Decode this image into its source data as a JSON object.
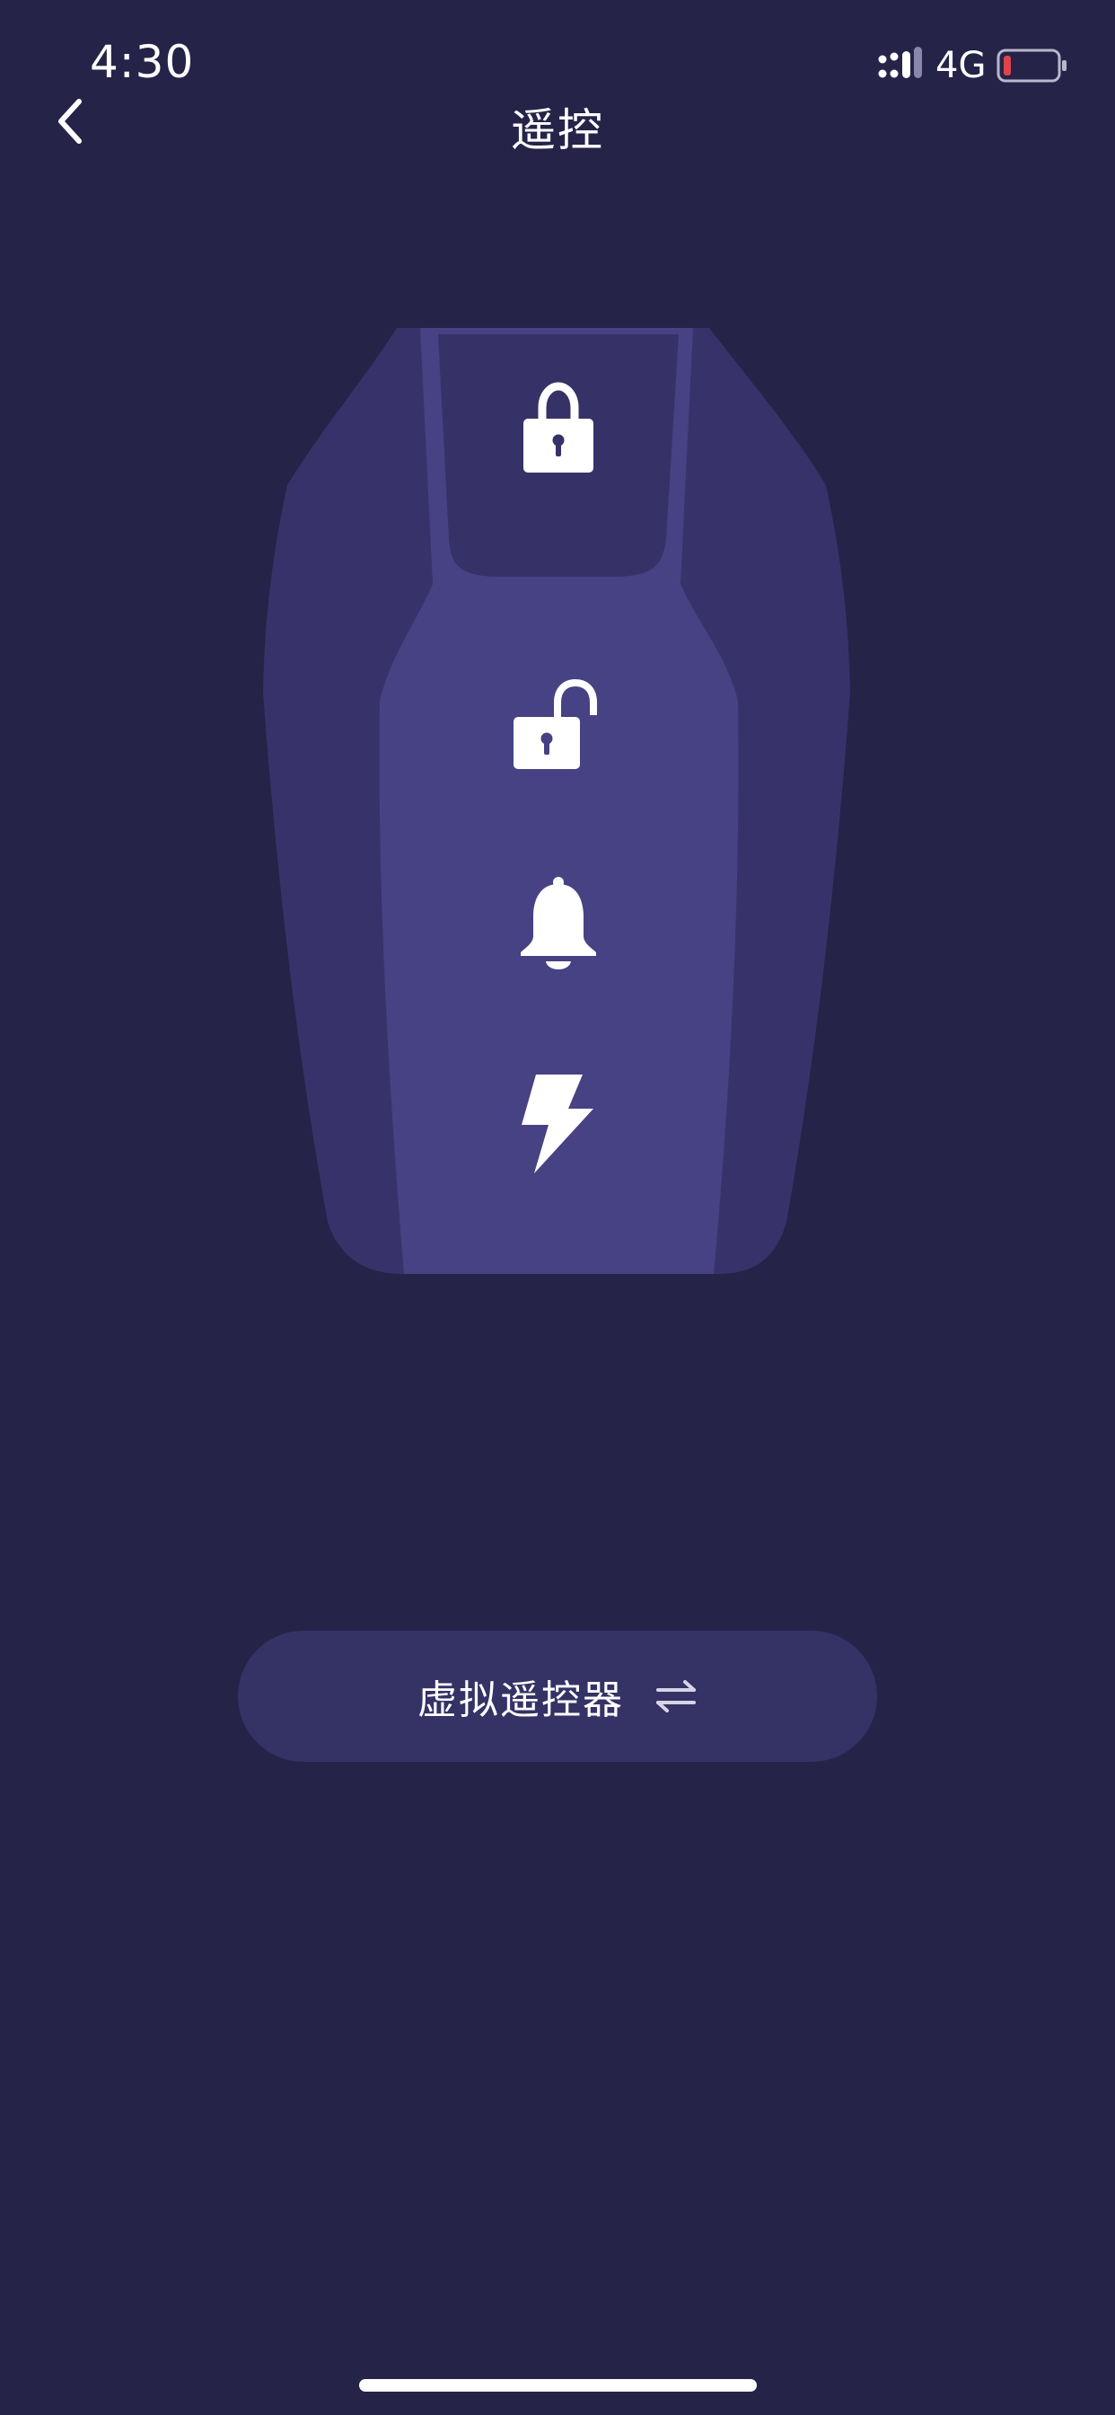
{
  "status_bar": {
    "time": "4:30",
    "network": "4G",
    "icons": [
      "signal-icon",
      "battery-icon"
    ]
  },
  "header": {
    "title": "遥控",
    "back_icon": "chevron-left-icon"
  },
  "key_fob": {
    "buttons": [
      {
        "name": "lock",
        "icon": "lock-icon"
      },
      {
        "name": "unlock",
        "icon": "unlock-icon"
      },
      {
        "name": "horn",
        "icon": "bell-icon"
      },
      {
        "name": "power",
        "icon": "lightning-icon"
      }
    ]
  },
  "virtual_remote": {
    "label": "虚拟遥控器",
    "icon": "swap-icon"
  },
  "colors": {
    "background": "#262349",
    "fob_outer": "#37336a",
    "fob_inner": "#464283",
    "button_bg": "#353266",
    "battery_low": "#e0434a"
  }
}
